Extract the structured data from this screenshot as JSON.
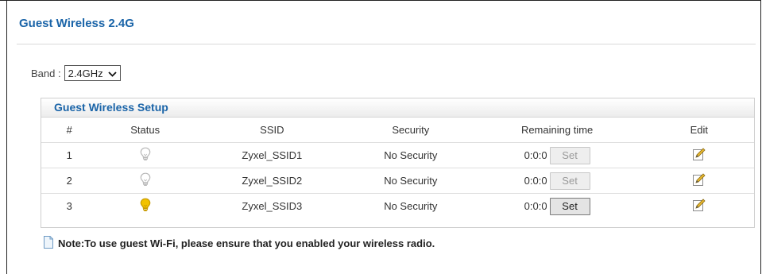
{
  "header": {
    "title": "Guest Wireless 2.4G"
  },
  "band": {
    "label": "Band :",
    "selected": "2.4GHz"
  },
  "panel": {
    "title": "Guest Wireless Setup",
    "columns": [
      "#",
      "Status",
      "SSID",
      "Security",
      "Remaining time",
      "Edit"
    ],
    "rows": [
      {
        "num": "1",
        "status": "inactive",
        "ssid": "Zyxel_SSID1",
        "security": "No Security",
        "time": "0:0:0",
        "set_label": "Set",
        "set_enabled": false
      },
      {
        "num": "2",
        "status": "inactive",
        "ssid": "Zyxel_SSID2",
        "security": "No Security",
        "time": "0:0:0",
        "set_label": "Set",
        "set_enabled": false
      },
      {
        "num": "3",
        "status": "active",
        "ssid": "Zyxel_SSID3",
        "security": "No Security",
        "time": "0:0:0",
        "set_label": "Set",
        "set_enabled": true
      }
    ]
  },
  "note": {
    "text": "Note:To use guest Wi-Fi, please ensure that you enabled your wireless radio."
  },
  "colors": {
    "accent": "#1a64a8",
    "bulb_active": "#f2c200",
    "bulb_inactive": "#b8b8b8"
  },
  "icons": {
    "status": "lightbulb-icon",
    "edit": "edit-icon",
    "note": "note-icon"
  }
}
